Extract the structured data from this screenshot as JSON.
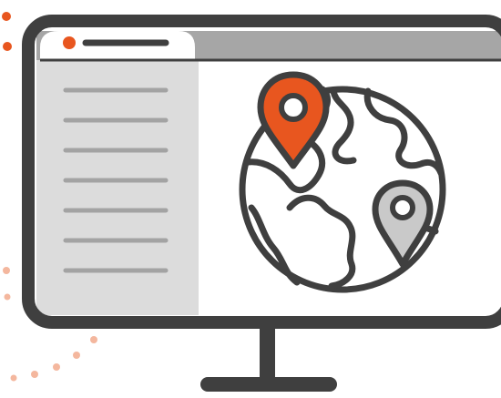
{
  "illustration": {
    "subject": "monitor-with-world-map-pins",
    "icons": [
      "monitor-icon",
      "globe-icon",
      "location-pin-icon",
      "location-pin-icon"
    ]
  },
  "colors": {
    "outline": "#3f3f3f",
    "accent": "#e8561f",
    "accent_light": "#f4b79e",
    "sidebar": "#dcdcdc",
    "titlebar": "#a6a6a6",
    "sidebar_lines": "#a3a3a3",
    "pin_secondary": "#c9c9c9",
    "screen": "#ffffff"
  },
  "sidebar": {
    "line_count": 7
  }
}
